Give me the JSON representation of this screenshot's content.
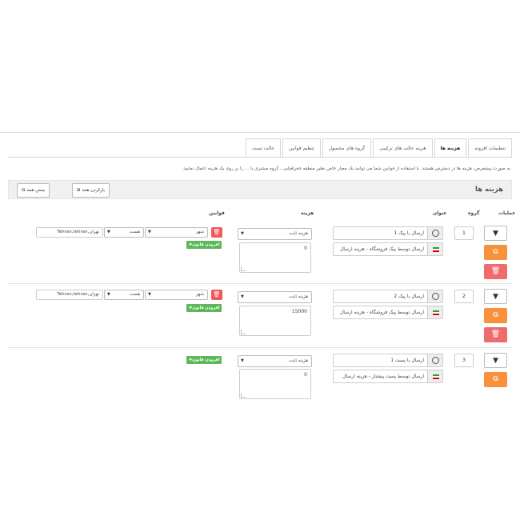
{
  "tabs": [
    {
      "label": "تنظیمات افزونه"
    },
    {
      "label": "هزینه ها"
    },
    {
      "label": "هزینه حالت های ترکیبی"
    },
    {
      "label": "گروه های محصول"
    },
    {
      "label": "تنظیم قوانین"
    },
    {
      "label": "حالت تست"
    }
  ],
  "help_text": "به صورت پیشفرض، هزینه ها در دسترس هستند. با استفاده از قوانین شما می توانید یک معیار خاص نظیر منطقه جغرافیایی ، گروه مشتری یا ... را بر روی یک هزینه اعمال نمایید.",
  "panel": {
    "title": "هزینه ها",
    "expand_all": "بازکردن همه",
    "collapse_all": "بستن همه"
  },
  "columns": {
    "operations": "عملیات",
    "group": "گروه",
    "title": "عنوان",
    "cost": "هزینه",
    "rules": "قوانین"
  },
  "rows": [
    {
      "group": "1",
      "title": "ارسال با پیک 1",
      "description": "ارسال توسط پیک فروشگاه - هزینه ارسال",
      "cost_type": "هزینه ثابت",
      "cost_value": "0",
      "rule": {
        "field": "شهر",
        "operator": "هست",
        "value": "تهران,Tehran,tehran"
      },
      "add_rule": "افزودن قانون"
    },
    {
      "group": "2",
      "title": "ارسال با پیک 2",
      "description": "ارسال توسط پیک فروشگاه - هزینه ارسال",
      "cost_type": "هزینه ثابت",
      "cost_value": "15000",
      "rule": {
        "field": "شهر",
        "operator": "هست",
        "value": "تهران,Tehran,tehran"
      },
      "add_rule": "افزودن قانون"
    },
    {
      "group": "3",
      "title": "ارسال با پست 1",
      "description": "ارسال توسط پست پیشتاز - هزینه ارسال",
      "cost_type": "هزینه ثابت",
      "cost_value": "0",
      "add_rule": "افزودن قانون"
    }
  ],
  "colors": {
    "delete": "#f05a5a",
    "duplicate": "#f7923a",
    "add_rule": "#5cb85c",
    "panel_bg": "#eef0f2"
  },
  "icons": {
    "toggle": "chevron-down-icon",
    "duplicate": "copy-icon",
    "delete": "trash-icon",
    "title_addon": "dial-icon",
    "description_addon": "iran-flag-icon"
  }
}
